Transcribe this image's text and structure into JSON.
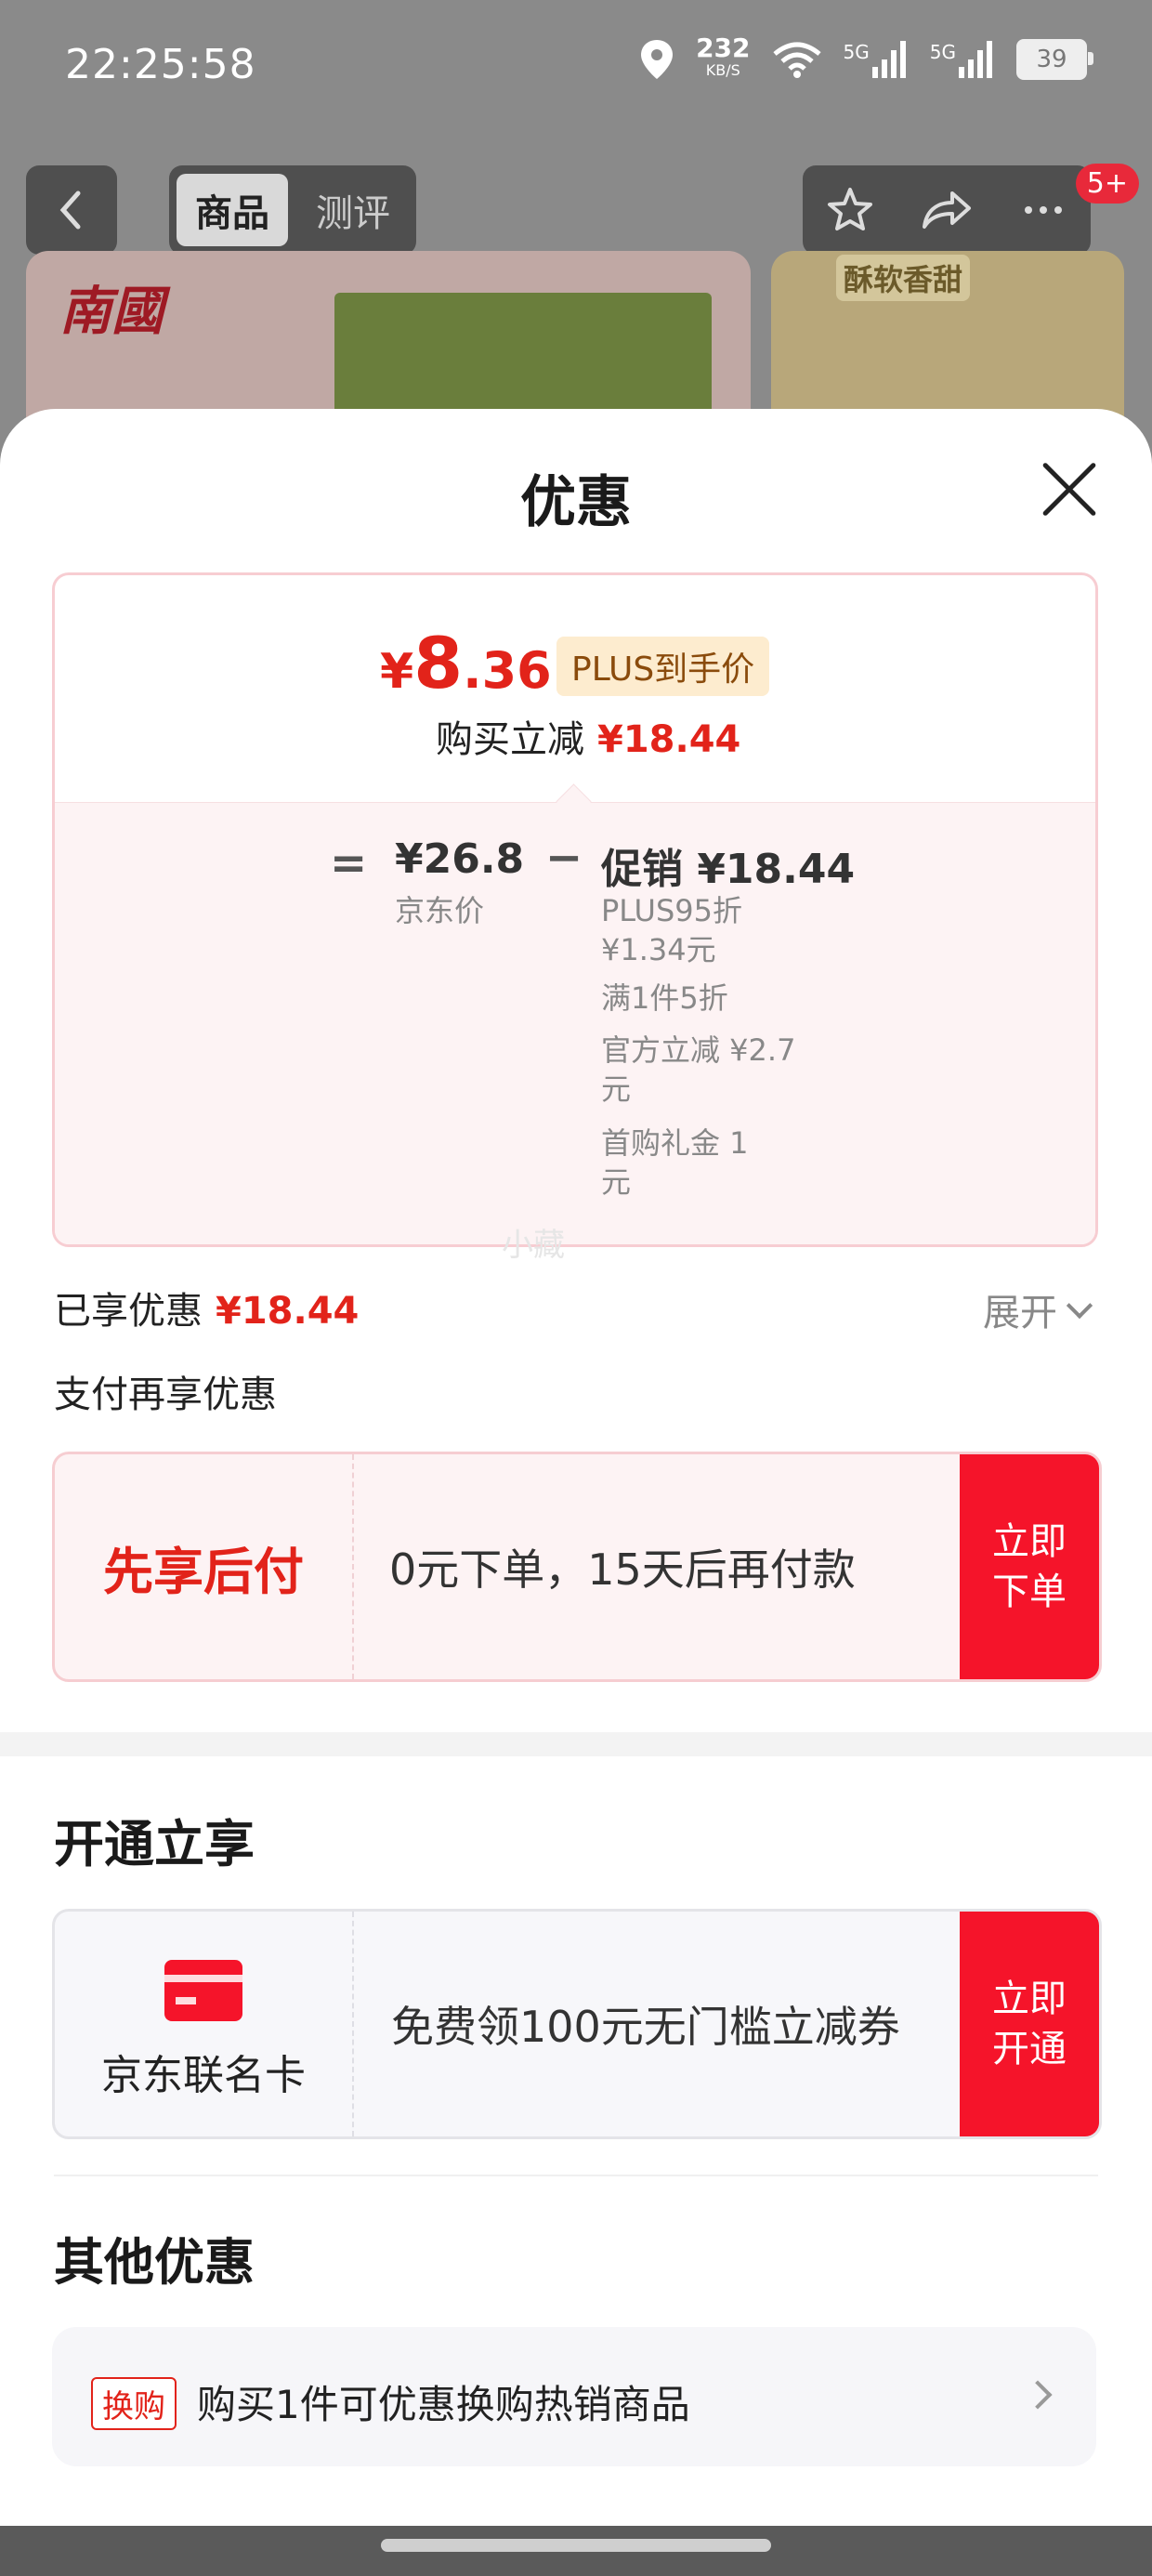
{
  "status_bar": {
    "time": "22:25:58",
    "speed_value": "232",
    "speed_unit": "KB/S",
    "signal1": "5G",
    "signal2": "5G",
    "battery": "39"
  },
  "background": {
    "tab_product": "商品",
    "tab_review": "测评",
    "notif_badge": "5+",
    "brand": "南國",
    "right_card_title": "酥软香甜"
  },
  "sheet": {
    "title": "优惠"
  },
  "price": {
    "currency": "¥",
    "final_int": "8",
    "final_dec": ".36",
    "plus_tag": "PLUS到手价",
    "reduce_label": "购买立减",
    "reduce_value": "¥18.44",
    "equals": "=",
    "jd_price": "¥26.8",
    "jd_label": "京东价",
    "minus": "−",
    "promo_label": "促销 ¥18.44",
    "promo_items": [
      "PLUS95折 ¥1.34元",
      "满1件5折",
      "官方立减 ¥2.7元",
      "首购礼金 1元"
    ]
  },
  "watermark": "小藏",
  "enjoyed": {
    "label": "已享优惠",
    "value": "¥18.44",
    "expand": "展开"
  },
  "pay_more_title": "支付再享优惠",
  "pay_later": {
    "title": "先享后付",
    "desc": "0元下单，15天后再付款",
    "button": "立即下单"
  },
  "open_section": {
    "title": "开通立享",
    "card_label": "京东联名卡",
    "desc": "免费领100元无门槛立减券",
    "button": "立即开通"
  },
  "other_section": {
    "title": "其他优惠",
    "tag": "换购",
    "desc": "购买1件可优惠换购热销商品"
  }
}
